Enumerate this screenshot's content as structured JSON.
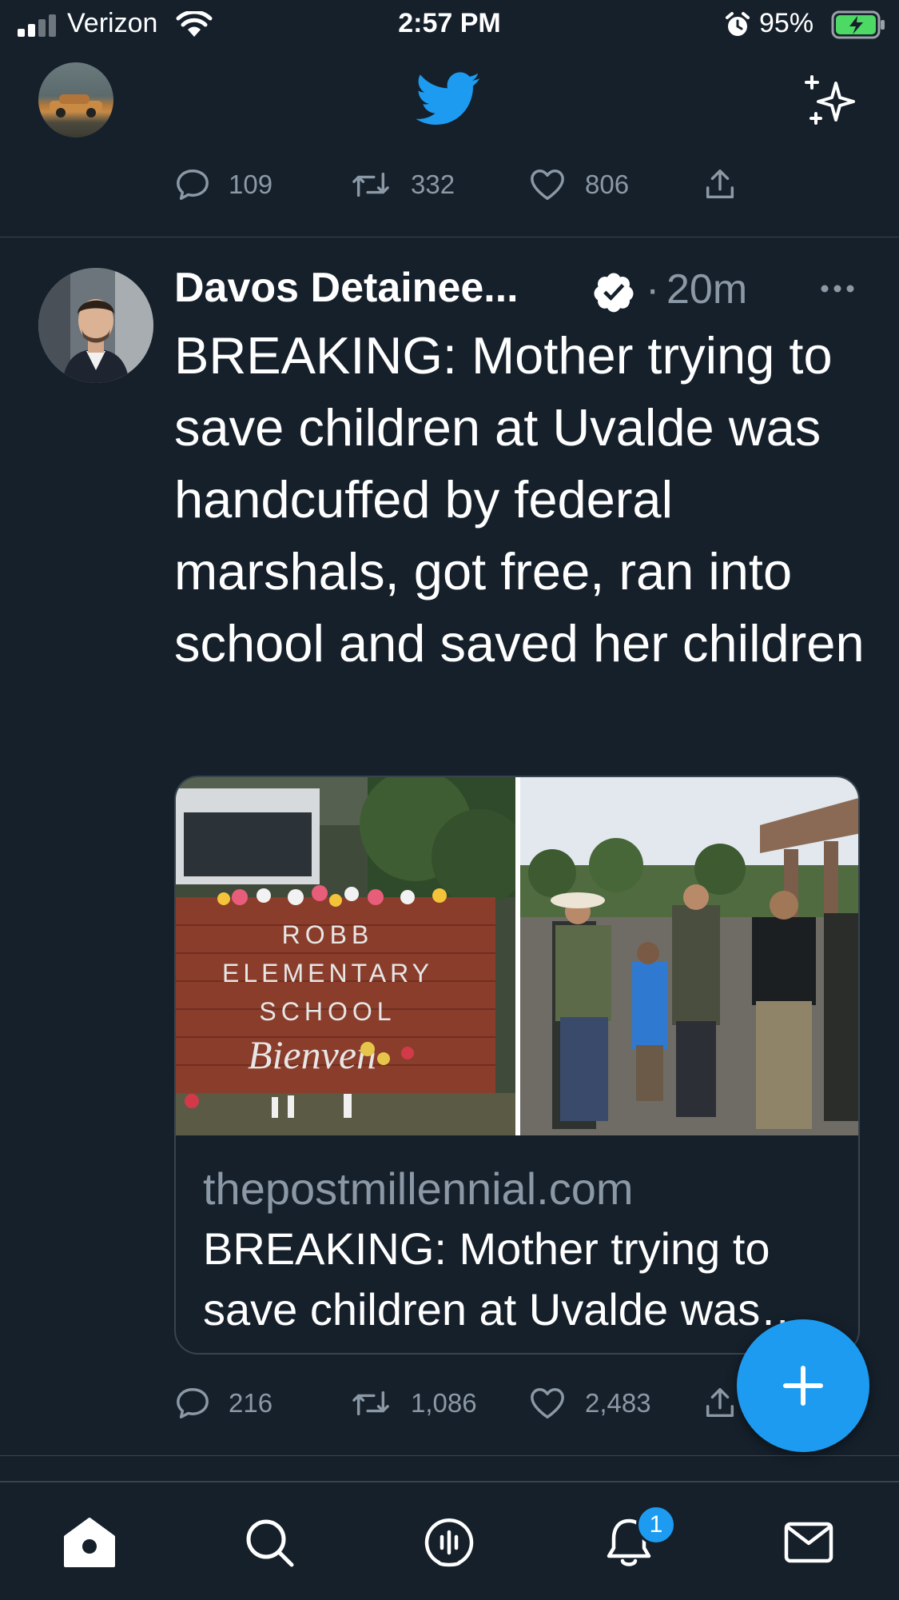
{
  "status_bar": {
    "carrier": "Verizon",
    "time": "2:57 PM",
    "battery_percent": "95%"
  },
  "header": {
    "avatar_icon": "profile-avatar",
    "logo_icon": "twitter-bird-icon",
    "sparkle_icon": "sparkle-icon"
  },
  "previous_tweet": {
    "replies": "109",
    "retweets": "332",
    "likes": "806"
  },
  "tweet": {
    "author_name": "Davos Detainee...",
    "verified": true,
    "dot": "·",
    "time": "20m",
    "text": "BREAKING: Mother trying to save children at Uvalde was handcuffed by federal marshals, got free, ran into school and saved her children",
    "card": {
      "image_left_text": [
        "ROBB",
        "ELEMENTARY",
        "SCHOOL",
        "Bienven"
      ],
      "domain": "thepostmillennial.com",
      "title": "BREAKING: Mother trying to save children at Uvalde was handcuffed by federal marshals, got free, ran into school and saved her children"
    },
    "replies": "216",
    "retweets": "1,086",
    "likes": "2,483"
  },
  "bottom_nav": {
    "items": [
      "home-icon",
      "search-icon",
      "spaces-icon",
      "notifications-icon",
      "messages-icon"
    ],
    "notification_badge": "1"
  },
  "colors": {
    "background": "#15202b",
    "accent": "#1d9bf0",
    "muted_text": "#8b98a5",
    "divider": "#38444d"
  }
}
